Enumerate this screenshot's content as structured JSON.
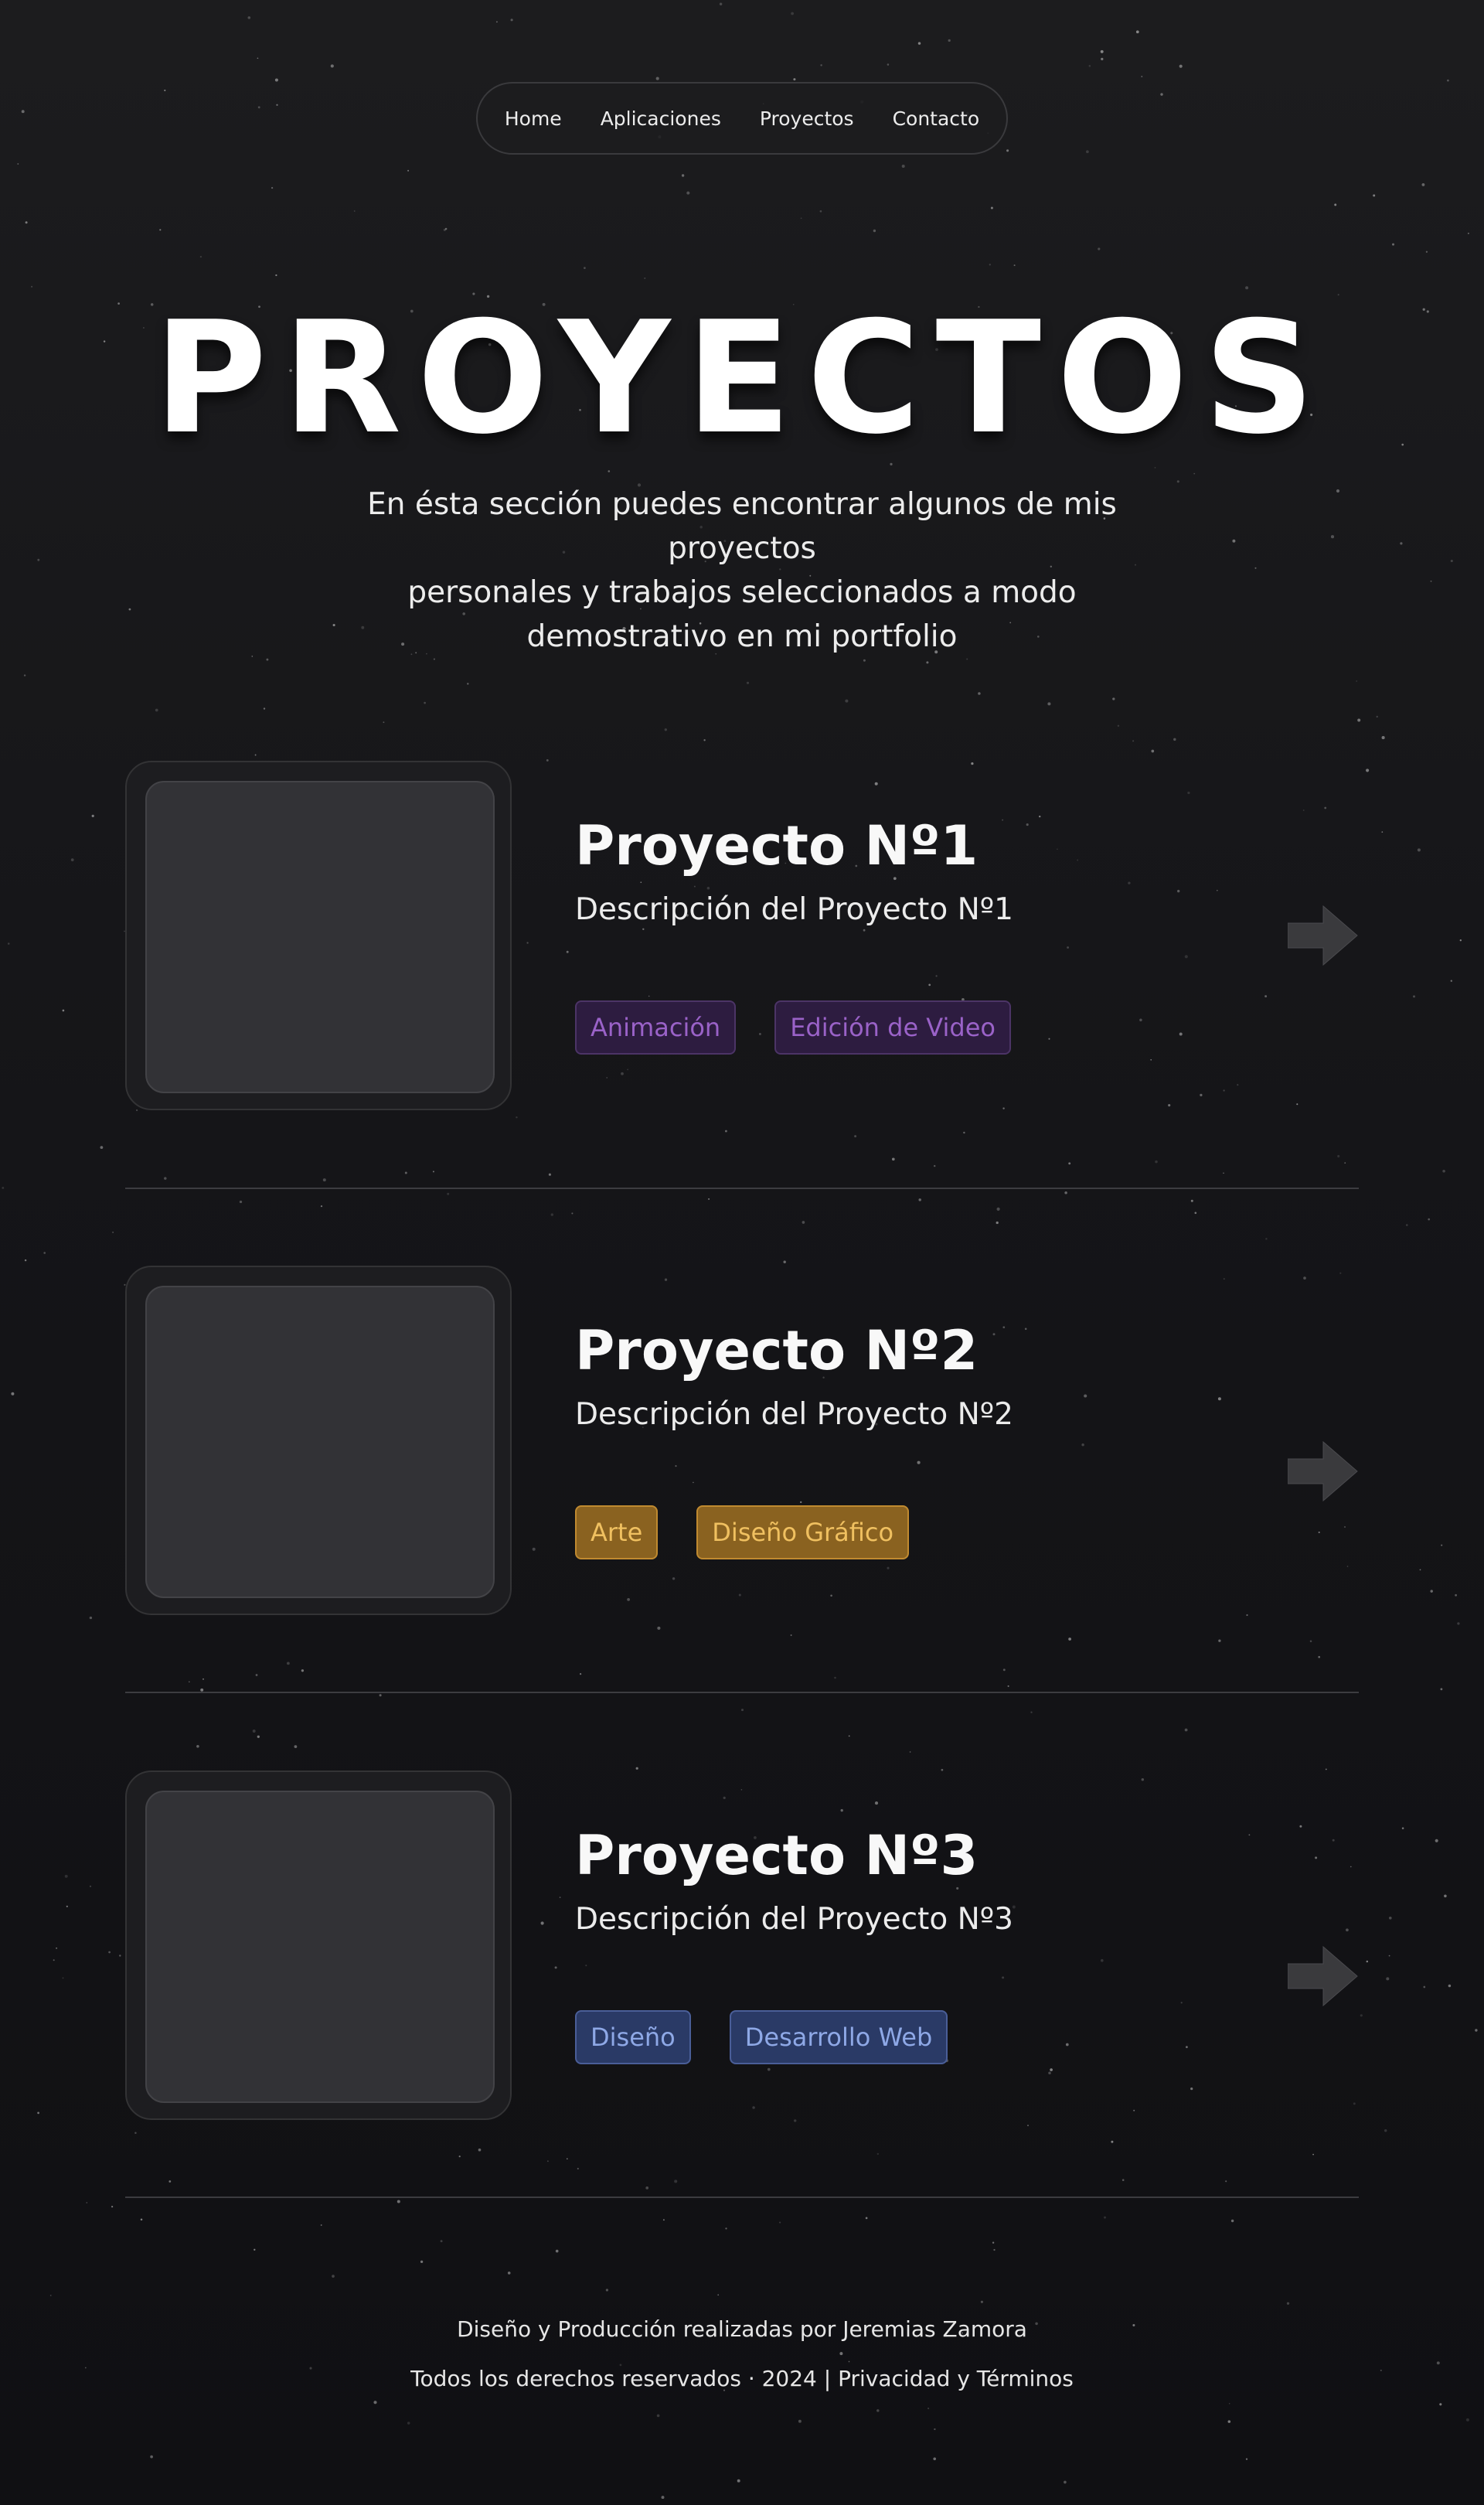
{
  "nav": {
    "items": [
      {
        "label": "Home"
      },
      {
        "label": "Aplicaciones"
      },
      {
        "label": "Proyectos"
      },
      {
        "label": "Contacto"
      }
    ]
  },
  "hero": {
    "title": "PROYECTOS",
    "subtitle_lines": [
      "En ésta sección puedes encontrar algunos de mis proyectos",
      "personales y trabajos seleccionados a modo",
      "demostrativo en mi portfolio"
    ]
  },
  "projects": [
    {
      "title": "Proyecto Nº1",
      "description": "Descripción del Proyecto Nº1",
      "tags": [
        {
          "label": "Animación",
          "color": "#9a62c8",
          "bg": "#2d1c40",
          "border": "#4c3466"
        },
        {
          "label": "Edición de Video",
          "color": "#9a62c8",
          "bg": "#2d1c40",
          "border": "#4c3466"
        }
      ],
      "arrow_icon": "arrow-right-icon"
    },
    {
      "title": "Proyecto Nº2",
      "description": "Descripción del Proyecto Nº2",
      "tags": [
        {
          "label": "Arte",
          "color": "#f0c060",
          "bg": "#8a6220",
          "border": "#c08a30"
        },
        {
          "label": "Diseño Gráfico",
          "color": "#f0c060",
          "bg": "#8a6220",
          "border": "#c08a30"
        }
      ],
      "arrow_icon": "arrow-right-icon"
    },
    {
      "title": "Proyecto Nº3",
      "description": "Descripción del Proyecto Nº3",
      "tags": [
        {
          "label": "Diseño",
          "color": "#8ea8e6",
          "bg": "#2a3a66",
          "border": "#4a5e98"
        },
        {
          "label": "Desarrollo Web",
          "color": "#8ea8e6",
          "bg": "#2a3a66",
          "border": "#4a5e98"
        }
      ],
      "arrow_icon": "arrow-right-icon"
    }
  ],
  "footer": {
    "credits": "Diseño y Producción realizadas por Jeremias Zamora",
    "rights": "Todos los derechos reservados · 2024",
    "separator": "|",
    "legal_link": "Privacidad y Términos"
  },
  "colors": {
    "background": "#151518",
    "arrow": "#3a3a3d",
    "divider": "#3c3c40"
  }
}
